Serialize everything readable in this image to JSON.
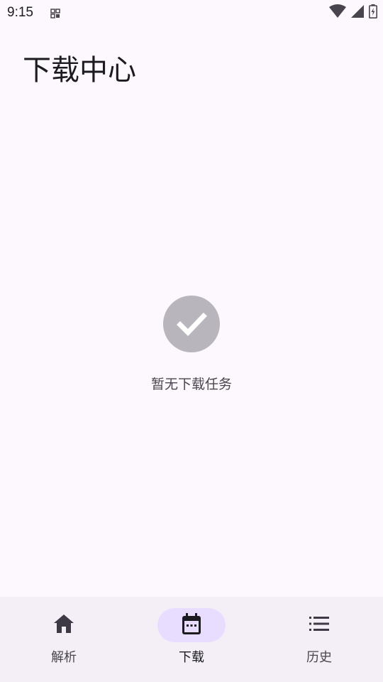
{
  "status_bar": {
    "time": "9:15",
    "icons": [
      "notification-grid-icon",
      "wifi-icon",
      "cell-signal-icon",
      "battery-charging-icon"
    ]
  },
  "header": {
    "title": "下载中心"
  },
  "empty_state": {
    "icon": "check-circle-icon",
    "message": "暂无下载任务"
  },
  "bottom_nav": {
    "items": [
      {
        "label": "解析",
        "icon": "home-icon",
        "active": false
      },
      {
        "label": "下载",
        "icon": "calendar-icon",
        "active": true
      },
      {
        "label": "历史",
        "icon": "list-icon",
        "active": false
      }
    ]
  },
  "colors": {
    "background": "#fdf8fd",
    "nav_background": "#f4eff7",
    "active_indicator": "#e9ddff",
    "empty_icon": "#b9b5bc",
    "text_primary": "#1c1b1f",
    "text_secondary": "#49454f"
  }
}
